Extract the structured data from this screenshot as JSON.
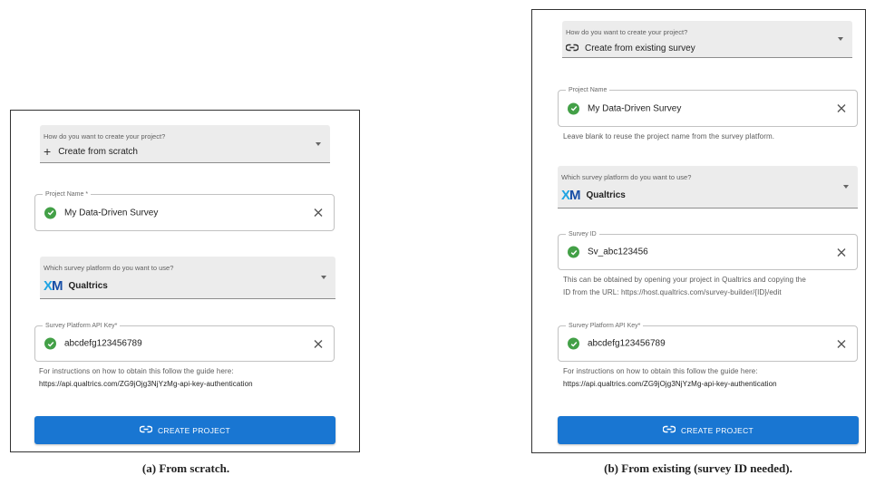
{
  "panel_a": {
    "create_select": {
      "label": "How do you want to create your project?",
      "value": "Create from scratch",
      "icon": "plus-icon"
    },
    "project_name": {
      "label": "Project Name *",
      "value": "My Data-Driven Survey"
    },
    "platform_select": {
      "label": "Which survey platform do you want to use?",
      "value": "Qualtrics",
      "logo_x": "X",
      "logo_m": "M"
    },
    "api_key": {
      "label": "Survey Platform API Key*",
      "value": "abcdefg123456789"
    },
    "api_help": {
      "line1": "For instructions on how to obtain this follow the guide here:",
      "line2": "https://api.qualtrics.com/ZG9jOjg3NjYzMg-api-key-authentication"
    },
    "create_button": {
      "label": "CREATE PROJECT"
    },
    "caption": "(a) From scratch."
  },
  "panel_b": {
    "create_select": {
      "label": "How do you want to create your project?",
      "value": "Create from existing survey",
      "icon": "link-icon"
    },
    "project_name": {
      "label": "Project Name",
      "value": "My Data-Driven Survey",
      "help": "Leave blank to reuse the project name from the survey platform."
    },
    "platform_select": {
      "label": "Which survey platform do you want to use?",
      "value": "Qualtrics",
      "logo_x": "X",
      "logo_m": "M"
    },
    "survey_id": {
      "label": "Survey ID",
      "value": "Sv_abc123456",
      "help_line1": "This can be obtained by opening your project in Qualtrics and copying the",
      "help_line2": "ID from the URL: https://host.qualtrics.com/survey-builder/{ID}/edit"
    },
    "api_key": {
      "label": "Survey Platform API Key*",
      "value": "abcdefg123456789"
    },
    "api_help": {
      "line1": "For instructions on how to obtain this follow the guide here:",
      "line2": "https://api.qualtrics.com/ZG9jOjg3NjYzMg-api-key-authentication"
    },
    "create_button": {
      "label": "CREATE PROJECT"
    },
    "caption": "(b) From existing (survey ID needed)."
  },
  "colors": {
    "primary": "#1976d2",
    "success": "#43a047",
    "xm_light": "#1fa4e3",
    "xm_dark": "#174ea6"
  }
}
